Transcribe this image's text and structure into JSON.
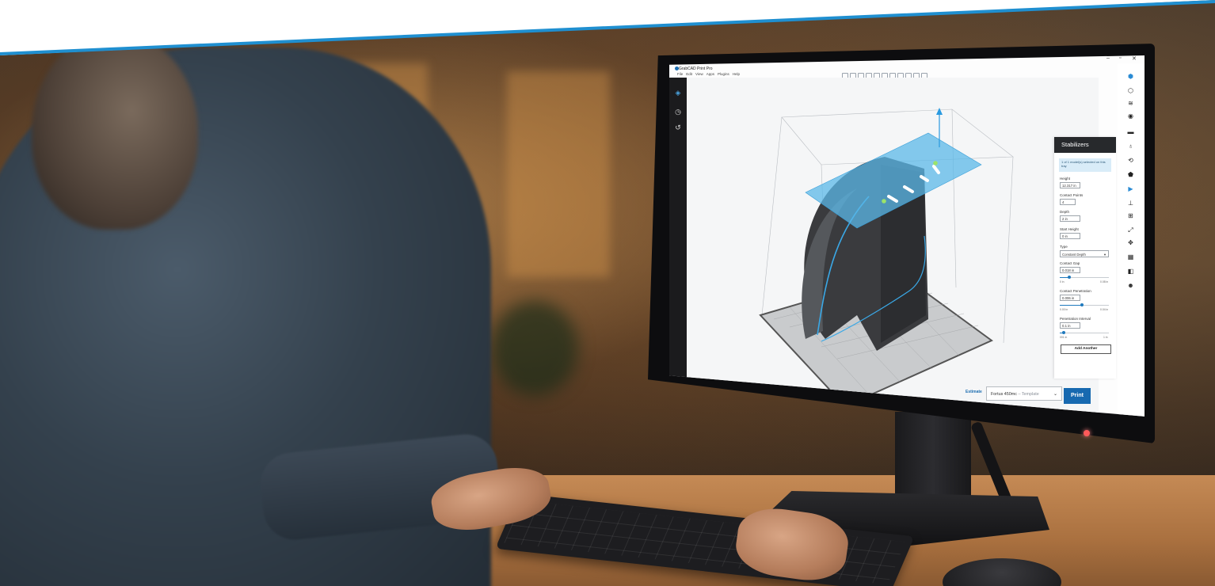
{
  "app": {
    "title": "GrabCAD Print Pro",
    "menu": [
      "File",
      "Edit",
      "View",
      "Apps",
      "Plugins",
      "Help"
    ],
    "window_controls": [
      "–",
      "▫",
      "✕"
    ]
  },
  "panel": {
    "title": "Stabilizers",
    "info": "1 of 1 model(s) selected on this tray",
    "fields": {
      "height": {
        "label": "Height",
        "value": "12.317 in"
      },
      "contact_points": {
        "label": "Contact Points",
        "value": "4"
      },
      "depth": {
        "label": "Depth",
        "value": "2 in"
      },
      "start_height": {
        "label": "Start Height",
        "value": "0 in"
      },
      "type": {
        "label": "Type",
        "value": "Constant Depth"
      },
      "contact_gap": {
        "label": "Contact Gap",
        "value": "0.018 in",
        "min": "0 in",
        "max": "0.08 in",
        "level": 0.2
      },
      "contact_penetration": {
        "label": "Contact Penetration",
        "value": "0.006 in",
        "min": "0.00 in",
        "max": "0.04 in",
        "level": 0.45
      },
      "penetration_interval": {
        "label": "Penetration Interval",
        "value": "0.1 in",
        "min": "001 in",
        "max": "1 in",
        "level": 0.08
      }
    },
    "add_button": "Add Another"
  },
  "bottom": {
    "estimate": "Estimate",
    "printer": "Fortus 450mc",
    "printer_sub": "– Template",
    "print": "Print"
  },
  "colors": {
    "accent": "#1f8fd0",
    "print_button": "#1769b0",
    "panel_header": "#27292c",
    "cut_plane": "#5bb8e8",
    "model": "#3a3b3e"
  }
}
